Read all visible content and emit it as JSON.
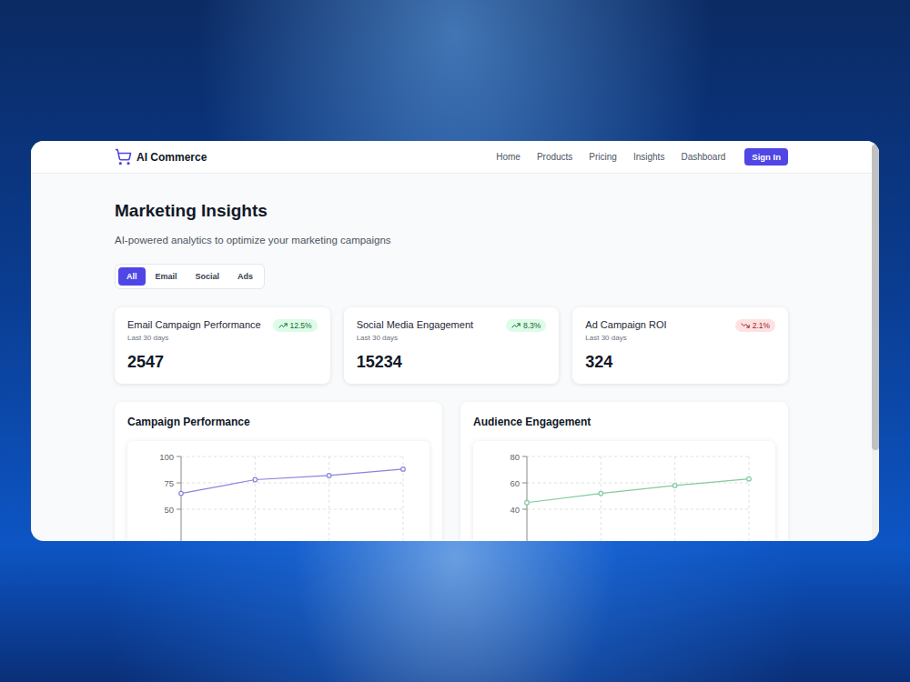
{
  "header": {
    "brand": "AI Commerce",
    "nav": [
      {
        "label": "Home"
      },
      {
        "label": "Products"
      },
      {
        "label": "Pricing"
      },
      {
        "label": "Insights"
      },
      {
        "label": "Dashboard"
      }
    ],
    "button": "Sign In"
  },
  "page": {
    "title": "Marketing Insights",
    "subtitle": "AI-powered analytics to optimize your marketing campaigns"
  },
  "filters": [
    {
      "label": "All",
      "selected": true
    },
    {
      "label": "Email",
      "selected": false
    },
    {
      "label": "Social",
      "selected": false
    },
    {
      "label": "Ads",
      "selected": false
    }
  ],
  "stats": [
    {
      "title": "Email Campaign Performance",
      "period": "Last 30 days",
      "value": "2547",
      "change": "12.5%",
      "trend": "up"
    },
    {
      "title": "Social Media Engagement",
      "period": "Last 30 days",
      "value": "15234",
      "change": "8.3%",
      "trend": "up"
    },
    {
      "title": "Ad Campaign ROI",
      "period": "Last 30 days",
      "value": "324",
      "change": "2.1%",
      "trend": "down"
    }
  ],
  "charts": [
    {
      "title": "Campaign Performance",
      "ticks": [
        "100",
        "75",
        "50"
      ],
      "values": [
        65,
        78,
        82,
        88
      ],
      "color": "#8884d8"
    },
    {
      "title": "Audience Engagement",
      "ticks": [
        "80",
        "60",
        "40"
      ],
      "values": [
        45,
        52,
        58,
        63
      ],
      "color": "#82ca9d"
    }
  ]
}
